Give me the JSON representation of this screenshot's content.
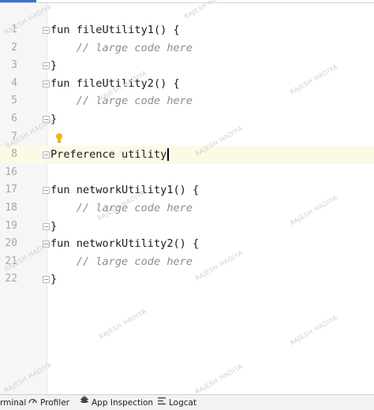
{
  "editor": {
    "lines": [
      {
        "num": "1",
        "text": "fun fileUtility1() {",
        "kind": "code",
        "fold": true
      },
      {
        "num": "2",
        "text": "    // large code here",
        "kind": "comment",
        "fold": false
      },
      {
        "num": "3",
        "text": "}",
        "kind": "code",
        "fold": true
      },
      {
        "num": "4",
        "text": "fun fileUtility2() {",
        "kind": "code",
        "fold": true
      },
      {
        "num": "5",
        "text": "    // large code here",
        "kind": "comment",
        "fold": false
      },
      {
        "num": "6",
        "text": "}",
        "kind": "code",
        "fold": true
      },
      {
        "num": "7",
        "text": "",
        "kind": "code",
        "fold": false
      },
      {
        "num": "8",
        "text": "Preference utility",
        "kind": "code",
        "fold": true
      },
      {
        "num": "16",
        "text": "",
        "kind": "code",
        "fold": false
      },
      {
        "num": "17",
        "text": "fun networkUtility1() {",
        "kind": "code",
        "fold": true
      },
      {
        "num": "18",
        "text": "    // large code here",
        "kind": "comment",
        "fold": false
      },
      {
        "num": "19",
        "text": "}",
        "kind": "code",
        "fold": true
      },
      {
        "num": "20",
        "text": "fun networkUtility2() {",
        "kind": "code",
        "fold": true
      },
      {
        "num": "21",
        "text": "    // large code here",
        "kind": "comment",
        "fold": false
      },
      {
        "num": "22",
        "text": "}",
        "kind": "code",
        "fold": true
      }
    ],
    "current_line": "8"
  },
  "watermark": {
    "text": "RAJESH HADIYA"
  },
  "statusbar": {
    "terminal": "rminal",
    "profiler": "Profiler",
    "app_inspection": "App Inspection",
    "logcat": "Logcat"
  },
  "colors": {
    "current_line_bg": "#fcf9e5",
    "comment": "#8c8c8c",
    "line_number": "#a6a6a6",
    "bulb": "#f2b21b"
  }
}
